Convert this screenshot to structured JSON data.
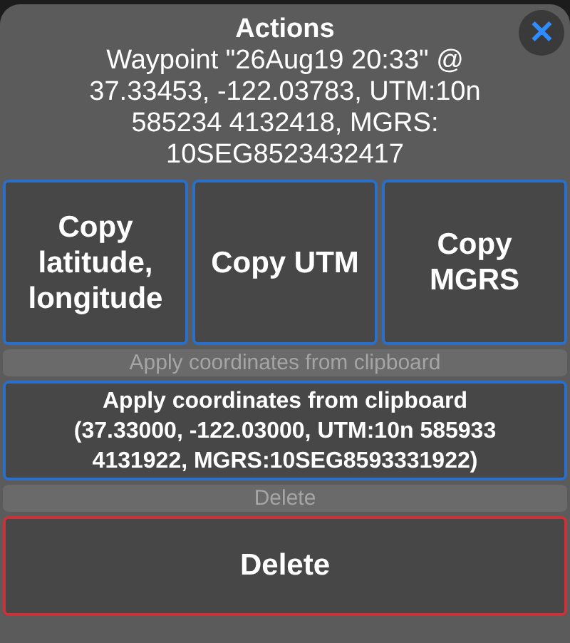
{
  "title": "Actions",
  "close": "✕",
  "message": "Waypoint \"26Aug19 20:33\" @\n37.33453, -122.03783, UTM:10n\n585234 4132418, MGRS:\n10SEG8523432417",
  "copy_buttons": [
    "Copy latitude, longitude",
    "Copy UTM",
    "Copy MGRS"
  ],
  "actions": [
    {
      "kind": "caption",
      "label": "Apply coordinates from clipboard"
    },
    {
      "kind": "button",
      "label": "Apply coordinates from clipboard\n(37.33000, -122.03000, UTM:10n 585933\n4131922, MGRS:10SEG8593331922)"
    },
    {
      "kind": "caption",
      "label": "Delete"
    },
    {
      "kind": "destructive",
      "label": "Delete"
    }
  ]
}
